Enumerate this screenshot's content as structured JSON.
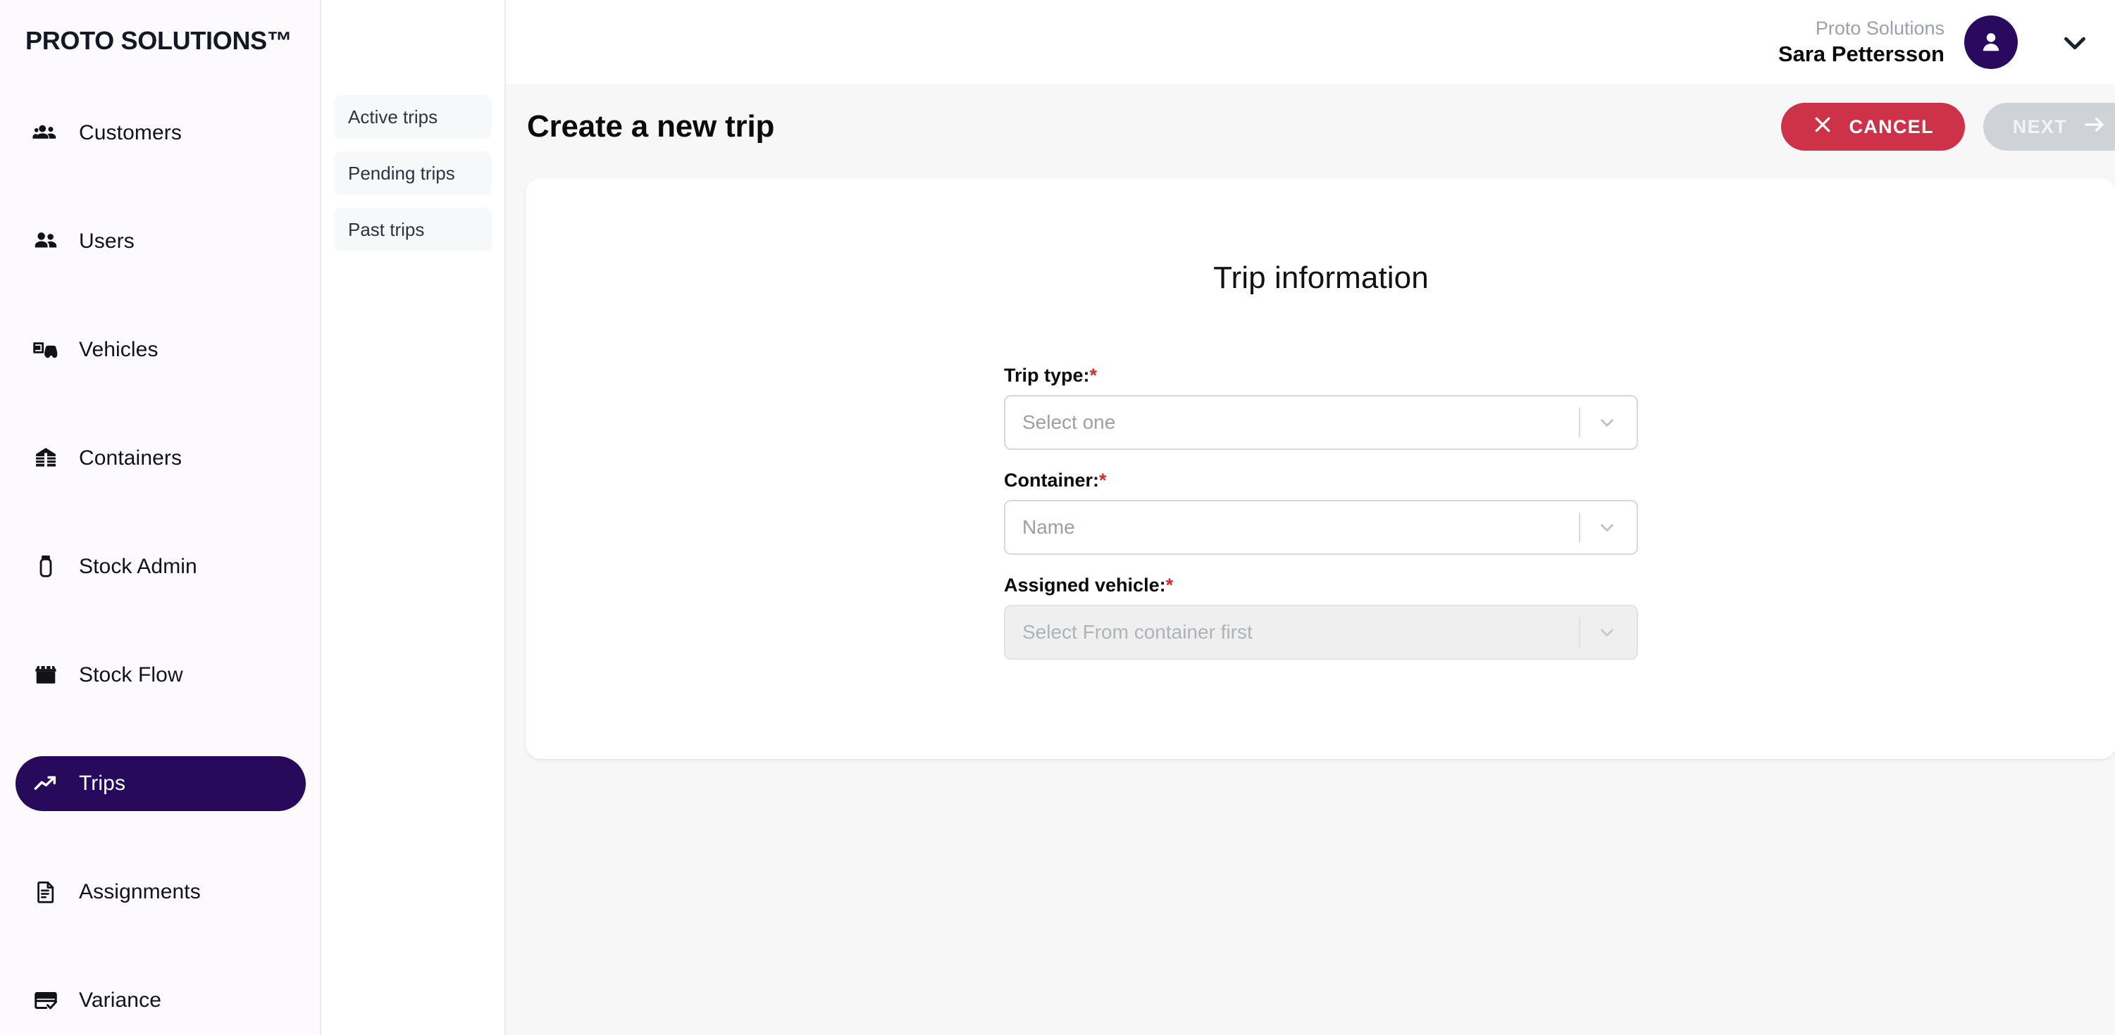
{
  "brand": {
    "name": "PROTO SOLUTIONS™"
  },
  "sidebar": {
    "items": [
      {
        "label": "Customers",
        "icon": "customers-icon",
        "active": false
      },
      {
        "label": "Users",
        "icon": "users-icon",
        "active": false
      },
      {
        "label": "Vehicles",
        "icon": "vehicles-icon",
        "active": false
      },
      {
        "label": "Containers",
        "icon": "containers-icon",
        "active": false
      },
      {
        "label": "Stock Admin",
        "icon": "stock-admin-icon",
        "active": false
      },
      {
        "label": "Stock Flow",
        "icon": "stock-flow-icon",
        "active": false
      },
      {
        "label": "Trips",
        "icon": "trips-icon",
        "active": true
      },
      {
        "label": "Assignments",
        "icon": "assignments-icon",
        "active": false
      },
      {
        "label": "Variance",
        "icon": "variance-icon",
        "active": false
      }
    ]
  },
  "subnav": {
    "items": [
      {
        "label": "Active trips"
      },
      {
        "label": "Pending trips"
      },
      {
        "label": "Past trips"
      }
    ]
  },
  "user": {
    "organization": "Proto Solutions",
    "name": "Sara Pettersson",
    "avatar_icon": "user-avatar-icon",
    "chevron_icon": "chevron-down-icon"
  },
  "header": {
    "title": "Create a new trip",
    "cancel_label": "CANCEL",
    "cancel_icon": "close-x-icon",
    "next_label": "NEXT",
    "next_icon": "arrow-right-icon",
    "next_disabled": true
  },
  "form": {
    "title": "Trip information",
    "required_marker": "*",
    "fields": [
      {
        "label": "Trip type:",
        "placeholder": "Select one",
        "value": "",
        "disabled": false,
        "required": true,
        "chevron_icon": "chevron-down-icon"
      },
      {
        "label": "Container:",
        "placeholder": "Name",
        "value": "",
        "disabled": false,
        "required": true,
        "chevron_icon": "chevron-down-icon"
      },
      {
        "label": "Assigned vehicle:",
        "placeholder": "Select From container first",
        "value": "",
        "disabled": true,
        "required": true,
        "chevron_icon": "chevron-down-icon"
      }
    ]
  },
  "colors": {
    "brand_purple": "#280A5C",
    "avatar_purple": "#2A0A5E",
    "danger_red": "#CE3248",
    "disabled_gray": "#CFD2D7",
    "sidebar_bg": "#FCFAFD",
    "surface_bg": "#F7F7F8",
    "required_red": "#D22B2B"
  }
}
